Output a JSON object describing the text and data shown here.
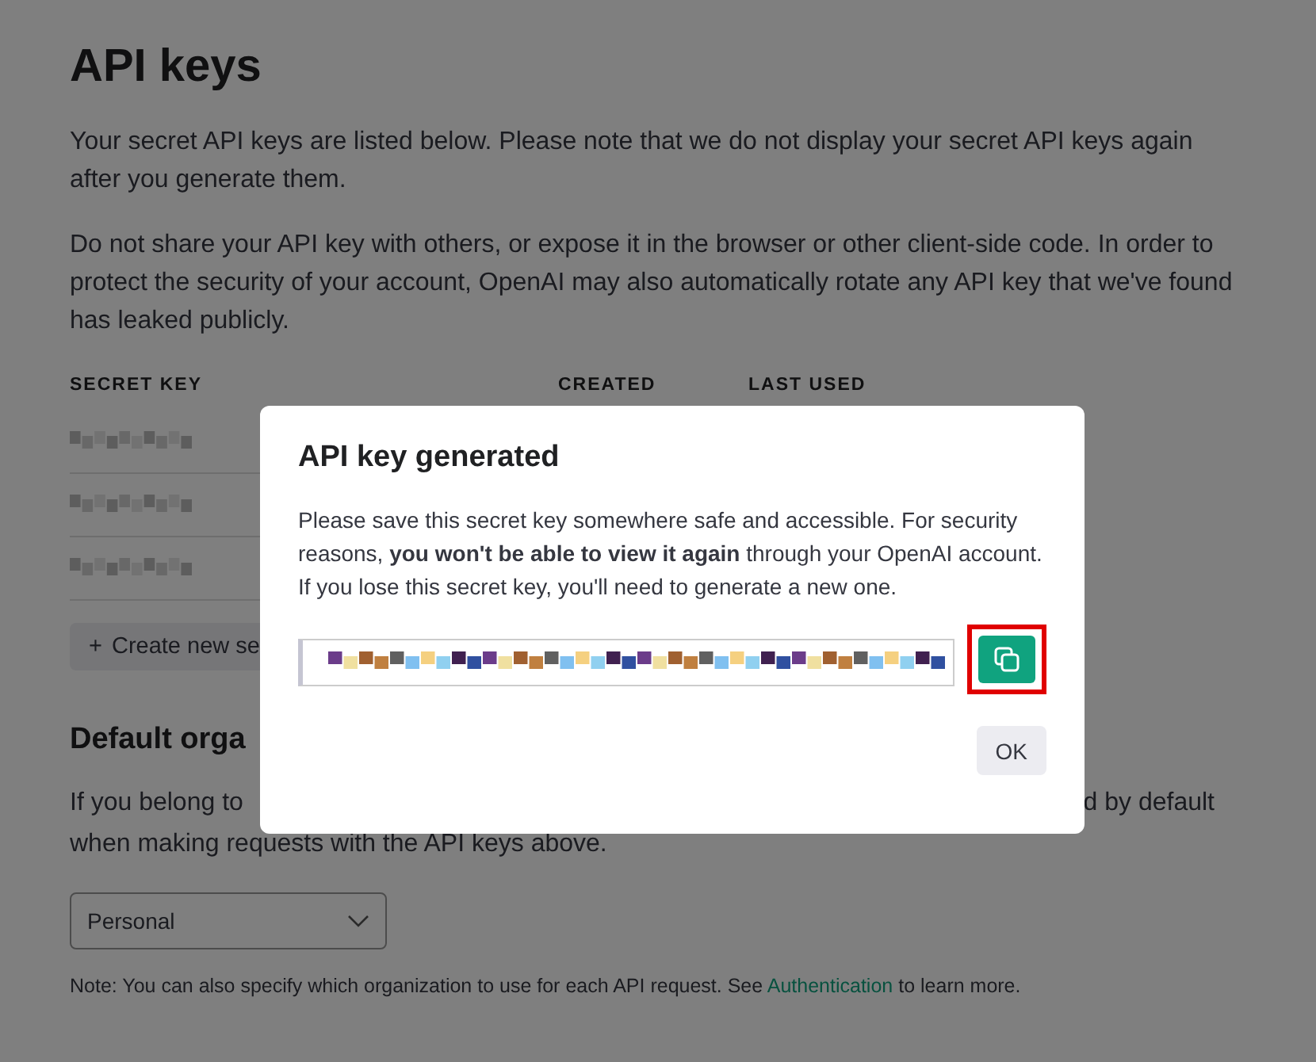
{
  "page": {
    "title": "API keys",
    "intro": [
      "Your secret API keys are listed below. Please note that we do not display your secret API keys again after you generate them.",
      "Do not share your API key with others, or expose it in the browser or other client-side code. In order to protect the security of your account, OpenAI may also automatically rotate any API key that we've found has leaked publicly."
    ],
    "table": {
      "columns": [
        "SECRET KEY",
        "CREATED",
        "LAST USED"
      ],
      "rows": [
        {
          "kind": "redacted"
        },
        {
          "kind": "redacted"
        },
        {
          "kind": "redacted"
        }
      ]
    },
    "create_button": {
      "icon": "+",
      "label": "Create new se"
    },
    "org_heading": "Default orga",
    "org_text": {
      "left": "If you belong to",
      "right": "d by default",
      "line_2": "when making requests with the API keys above."
    },
    "org_select": {
      "value": "Personal"
    },
    "note": {
      "before": "Note: You can also specify which organization to use for each API request. See",
      "link": "Authentication",
      "after": "to learn more."
    }
  },
  "dialog": {
    "title": "API key generated",
    "body": "Please save this secret key somewhere safe and accessible. For security reasons, **you won't be able to view it again** through your OpenAI account. If you lose this secret key, you'll need to generate a new one.",
    "key_field": {
      "kind": "redacted"
    },
    "copy_button": {
      "highlighted": true
    },
    "ok_button": "OK"
  }
}
